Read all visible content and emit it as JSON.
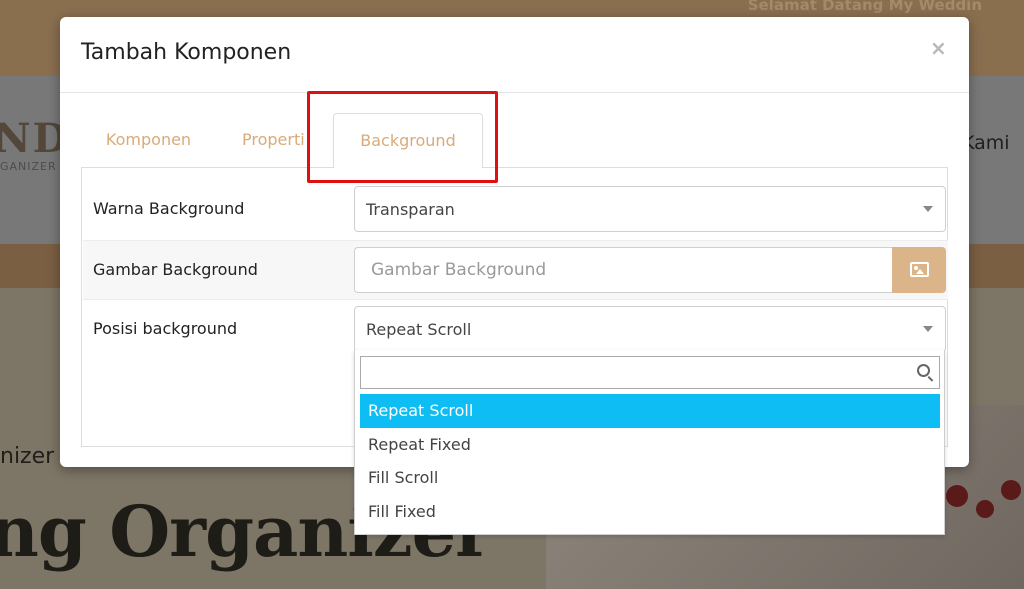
{
  "background_site": {
    "topbar_text": "Selamat Datang My Weddin",
    "logo_text": "NDA",
    "logo_sub": "GANIZER A",
    "nav_right": "Kami",
    "hero_small": "nizer",
    "hero_title": "ng Organizer"
  },
  "modal": {
    "title": "Tambah Komponen",
    "close_symbol": "×",
    "tabs": [
      {
        "label": "Komponen"
      },
      {
        "label": "Properti"
      },
      {
        "label": "Background",
        "active": true
      }
    ],
    "fields": {
      "warna": {
        "label": "Warna Background",
        "value": "Transparan"
      },
      "gambar": {
        "label": "Gambar Background",
        "placeholder": "Gambar Background",
        "button_icon": "image-icon"
      },
      "posisi": {
        "label": "Posisi background",
        "value": "Repeat Scroll"
      }
    }
  },
  "dropdown": {
    "search_value": "",
    "search_icon": "search-icon",
    "options": [
      "Repeat Scroll",
      "Repeat Fixed",
      "Fill Scroll",
      "Fill Fixed"
    ],
    "selected": "Repeat Scroll"
  },
  "colors": {
    "accent": "#dbb48a",
    "tab_text": "#d9ab79",
    "highlight_option": "#0ebdf3",
    "annotation_box": "#e01010"
  }
}
